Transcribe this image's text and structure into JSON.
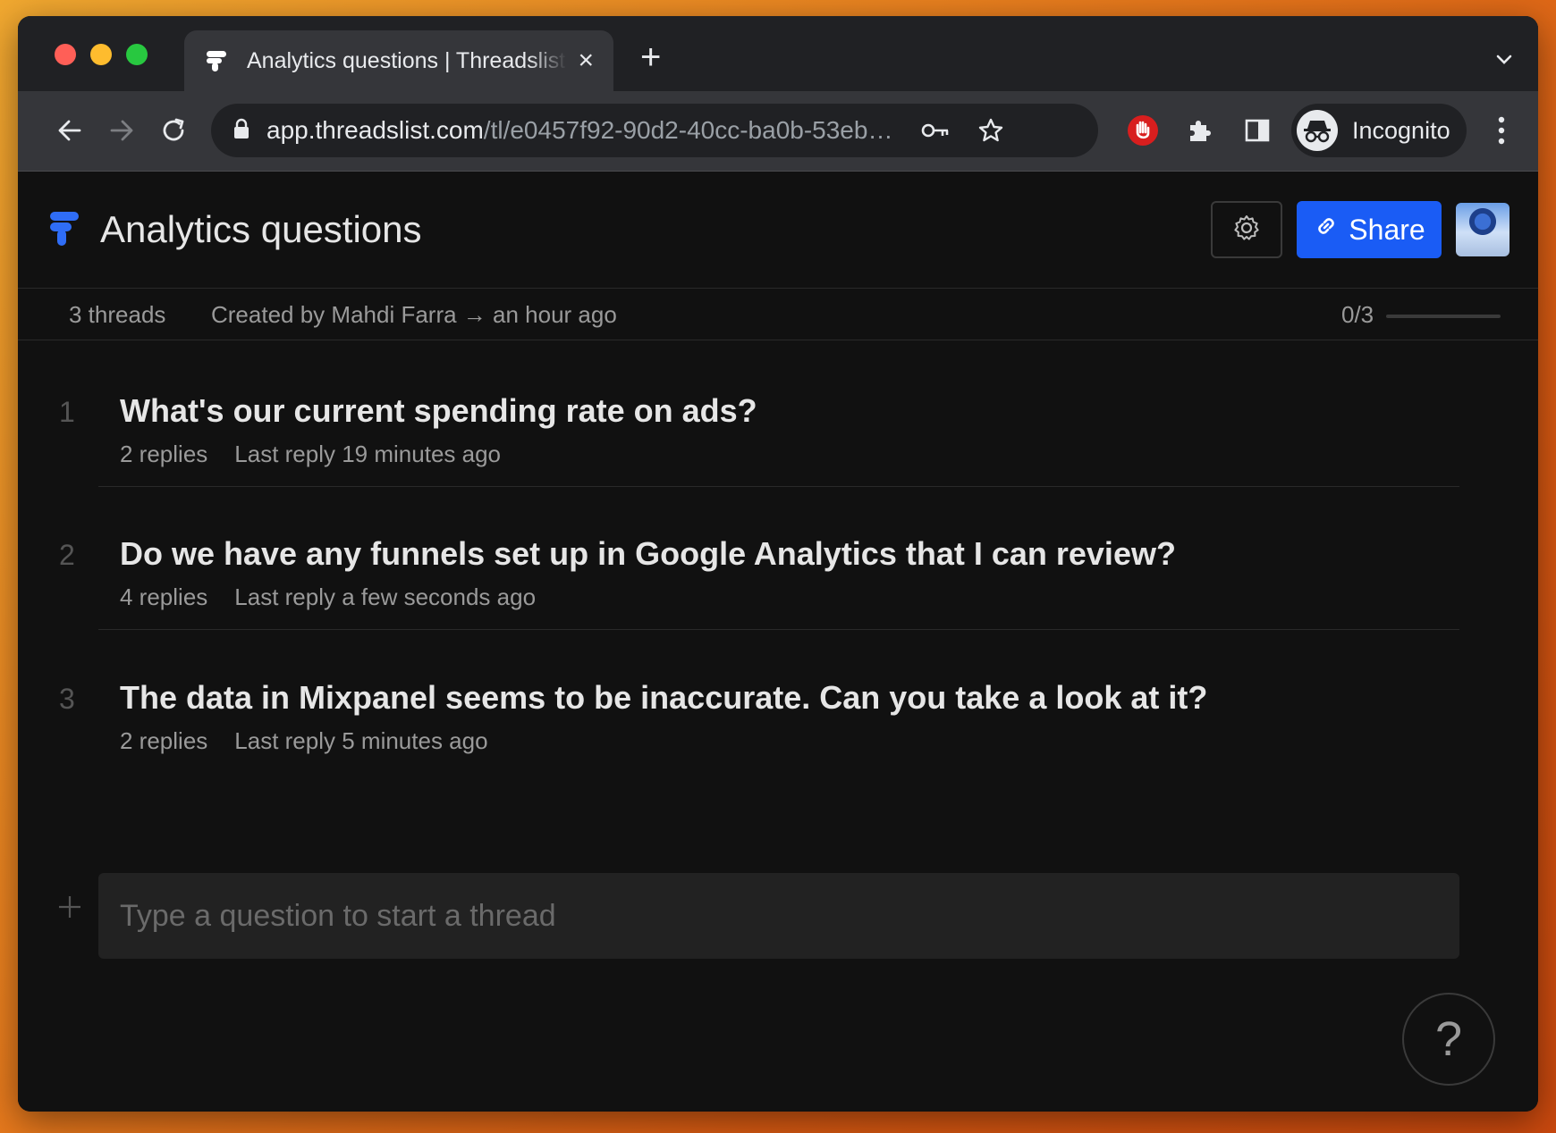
{
  "browser": {
    "tab": {
      "title": "Analytics questions | Threadslist",
      "close_icon": "×"
    },
    "new_tab_icon": "+",
    "url": {
      "host": "app.threadslist.com",
      "path": "/tl/e0457f92-90d2-40cc-ba0b-53eb…"
    },
    "profile": {
      "label": "Incognito"
    }
  },
  "header": {
    "title": "Analytics questions",
    "share_label": "Share"
  },
  "meta": {
    "thread_count": "3 threads",
    "created_by": "Created by Mahdi Farra → an hour ago",
    "progress": "0/3",
    "progress_fraction": 0
  },
  "threads": [
    {
      "number": "1",
      "question": "What's our current spending rate on ads?",
      "replies": "2 replies",
      "last_reply": "Last reply 19 minutes ago"
    },
    {
      "number": "2",
      "question": "Do we have any funnels set up in Google Analytics that I can review?",
      "replies": "4 replies",
      "last_reply": "Last reply a few seconds ago"
    },
    {
      "number": "3",
      "question": "The data in Mixpanel seems to be inaccurate. Can you take a look at it?",
      "replies": "2 replies",
      "last_reply": "Last reply 5 minutes ago"
    }
  ],
  "composer": {
    "placeholder": "Type a question to start a thread"
  },
  "help": {
    "label": "?"
  },
  "colors": {
    "accent": "#1a5cf5",
    "background": "#111111"
  }
}
